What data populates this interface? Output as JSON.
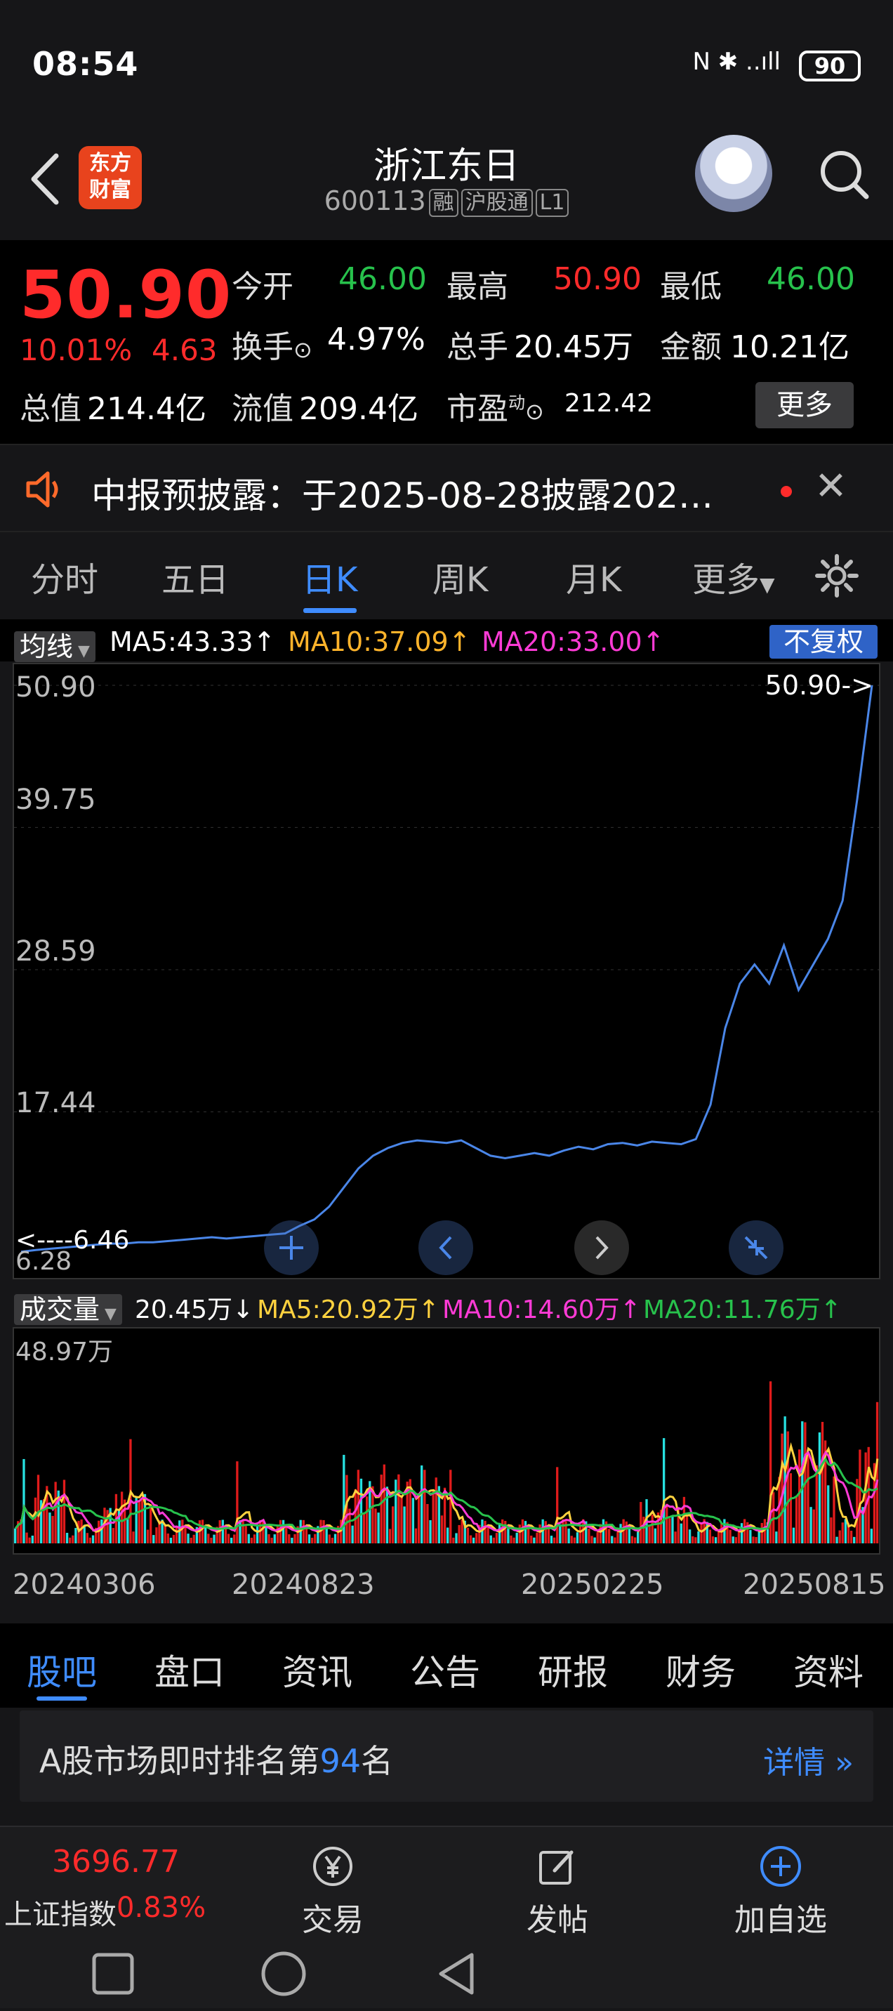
{
  "status_bar": {
    "time": "08:54",
    "battery": "90",
    "icons": "N ✱ ..ıll"
  },
  "header": {
    "stock_name": "浙江东日",
    "stock_code": "600113",
    "tags": [
      "融",
      "沪股通",
      "L1"
    ],
    "logo_line1": "东方",
    "logo_line2": "财富"
  },
  "quote": {
    "price": "50.90",
    "change_pct": "10.01%",
    "change_amt": "4.63",
    "open_label": "今开",
    "open": "46.00",
    "high_label": "最高",
    "high": "50.90",
    "low_label": "最低",
    "low": "46.00",
    "turnover_label": "换手",
    "turnover": "4.97%",
    "volume_label": "总手",
    "volume": "20.45万",
    "amount_label": "金额",
    "amount": "10.21亿",
    "mktcap_label": "总值",
    "mktcap": "214.4亿",
    "float_label": "流值",
    "float_cap": "209.4亿",
    "pe_label": "市盈",
    "pe_sup": "动",
    "pe": "212.42",
    "more_button": "更多"
  },
  "notice": {
    "text": "中报预披露：于2025-08-28披露202…"
  },
  "period_tabs": [
    "分时",
    "五日",
    "日K",
    "周K",
    "月K",
    "更多"
  ],
  "active_period": "日K",
  "ma": {
    "label": "均线",
    "ma5": "MA5:43.33",
    "ma10": "MA10:37.09",
    "ma20": "MA20:33.00",
    "adjust_button": "不复权"
  },
  "price_axis": [
    "50.90",
    "39.75",
    "28.59",
    "17.44",
    "6.28"
  ],
  "price_marker": "50.90->",
  "low_marker": "<----6.46",
  "volume": {
    "label": "成交量",
    "value": "20.45万",
    "ma5": "MA5:20.92万",
    "ma10": "MA10:14.60万",
    "ma20": "MA20:11.76万",
    "axis_max": "48.97万"
  },
  "date_labels": [
    "20240306",
    "20240823",
    "20250225",
    "20250815"
  ],
  "bottom_tabs": [
    "股吧",
    "盘口",
    "资讯",
    "公告",
    "研报",
    "财务",
    "资料"
  ],
  "rank": {
    "prefix": "A股市场即时排名第",
    "number": "94",
    "suffix": "名",
    "detail": "详情"
  },
  "index": {
    "value": "3696.77",
    "name": "上证指数",
    "pct": "0.83%"
  },
  "actions": {
    "trade": "交易",
    "post": "发帖",
    "add": "加自选"
  },
  "colors": {
    "up": "#ff2b2b",
    "down": "#27c24c",
    "accent": "#3f8cff",
    "ma5": "#ffd23f",
    "ma10": "#ff3bd6",
    "ma20": "#27c24c"
  },
  "chart_data": {
    "type": "line",
    "title": "",
    "y_range": [
      6.28,
      50.9
    ],
    "start_date": "20240306",
    "end_date": "20250815",
    "series": [
      {
        "values": [
          6.46,
          6.6,
          6.7,
          6.8,
          6.9,
          7.0,
          7.1,
          7.1,
          7.2,
          7.2,
          7.3,
          7.4,
          7.5,
          7.6,
          7.5,
          7.6,
          7.7,
          7.8,
          7.9,
          8.5,
          9.0,
          10.0,
          11.5,
          13.0,
          14.0,
          14.6,
          15.0,
          15.2,
          15.1,
          15.0,
          15.2,
          14.6,
          14.0,
          13.8,
          14.0,
          14.2,
          14.0,
          14.4,
          14.7,
          14.5,
          14.9,
          15.0,
          14.8,
          15.1,
          15.0,
          14.9,
          15.3,
          18.0,
          24.0,
          27.5,
          29.0,
          27.5,
          30.5,
          27.0,
          29.0,
          31.0,
          34.0,
          42.0,
          50.9
        ]
      }
    ],
    "volume_unit": "万",
    "volume_max": 48.97
  }
}
